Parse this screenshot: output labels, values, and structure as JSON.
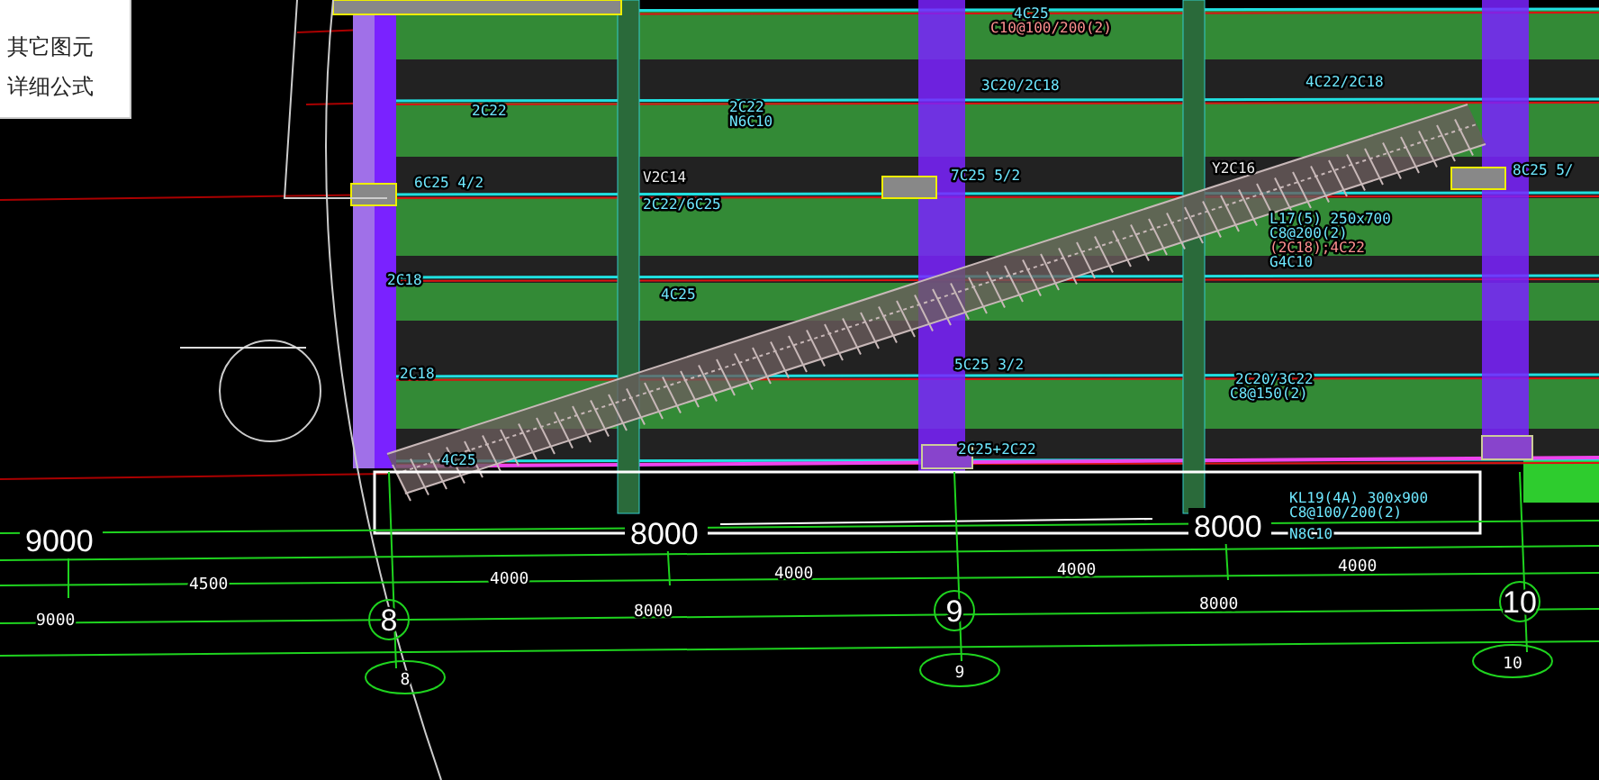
{
  "context_menu": {
    "items": [
      {
        "label": "其它图元"
      },
      {
        "label": "详细公式"
      }
    ]
  },
  "drawing": {
    "rebar_labels": [
      "2C22",
      "6C25 4/2",
      "2C22",
      "N6C10",
      "V2C14",
      "2C22/6C25",
      "4C25",
      "C10@100/200(2)",
      "3C20/2C18",
      "7C25 5/2",
      "4C22/2C18",
      "Y2C16",
      "L17(5) 250x700",
      "C8@200(2)",
      "(2C18);4C22",
      "G4C10",
      "2C18",
      "4C25",
      "2C18",
      "4C25",
      "5C25 3/2",
      "2C20/3C22",
      "C8@150(2)",
      "2C25+2C22",
      "KL19(4A) 300x900",
      "C8@100/200(2)",
      "N8C10",
      "8C25 5/"
    ],
    "span_dimensions": [
      "9000",
      "8000",
      "8000"
    ],
    "sub_dimensions": [
      "4500",
      "4000",
      "4000",
      "4000",
      "4000"
    ],
    "total_dimensions": [
      "9000",
      "8000",
      "8000"
    ],
    "axis_numbers": [
      "8",
      "9",
      "10"
    ],
    "axis_tags": [
      "8",
      "9",
      "10"
    ]
  }
}
